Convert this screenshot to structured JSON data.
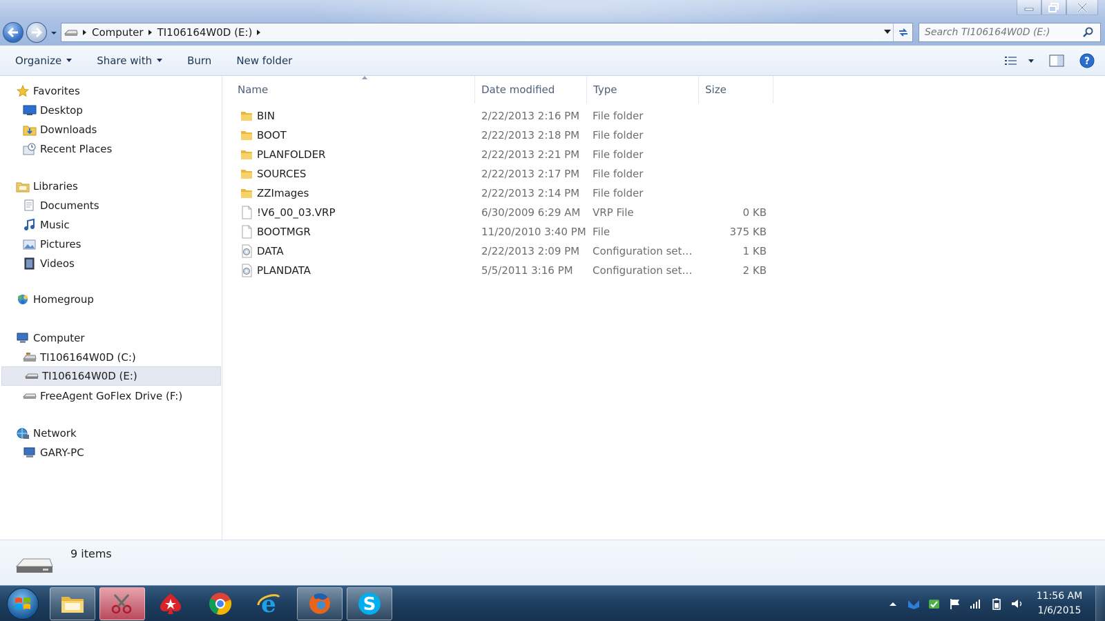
{
  "address": {
    "crumbs": [
      "Computer",
      "TI106164W0D (E:)"
    ]
  },
  "search": {
    "placeholder": "Search TI106164W0D (E:)"
  },
  "toolbar": {
    "organize": "Organize",
    "share_with": "Share with",
    "burn": "Burn",
    "new_folder": "New folder"
  },
  "nav": {
    "favorites": "Favorites",
    "desktop": "Desktop",
    "downloads": "Downloads",
    "recent_places": "Recent Places",
    "libraries": "Libraries",
    "documents": "Documents",
    "music": "Music",
    "pictures": "Pictures",
    "videos": "Videos",
    "homegroup": "Homegroup",
    "computer": "Computer",
    "drive_c": "TI106164W0D (C:)",
    "drive_e": "TI106164W0D (E:)",
    "drive_f": "FreeAgent GoFlex Drive (F:)",
    "network": "Network",
    "gary_pc": "GARY-PC"
  },
  "columns": {
    "name": "Name",
    "date": "Date modified",
    "type": "Type",
    "size": "Size"
  },
  "files": [
    {
      "name": "BIN",
      "date": "2/22/2013 2:16 PM",
      "type": "File folder",
      "size": "",
      "icon": "folder"
    },
    {
      "name": "BOOT",
      "date": "2/22/2013 2:18 PM",
      "type": "File folder",
      "size": "",
      "icon": "folder"
    },
    {
      "name": "PLANFOLDER",
      "date": "2/22/2013 2:21 PM",
      "type": "File folder",
      "size": "",
      "icon": "folder"
    },
    {
      "name": "SOURCES",
      "date": "2/22/2013 2:17 PM",
      "type": "File folder",
      "size": "",
      "icon": "folder"
    },
    {
      "name": "ZZImages",
      "date": "2/22/2013 2:14 PM",
      "type": "File folder",
      "size": "",
      "icon": "folder"
    },
    {
      "name": "!V6_00_03.VRP",
      "date": "6/30/2009 6:29 AM",
      "type": "VRP File",
      "size": "0 KB",
      "icon": "file"
    },
    {
      "name": "BOOTMGR",
      "date": "11/20/2010 3:40 PM",
      "type": "File",
      "size": "375 KB",
      "icon": "file"
    },
    {
      "name": "DATA",
      "date": "2/22/2013 2:09 PM",
      "type": "Configuration settin...",
      "size": "1 KB",
      "icon": "config"
    },
    {
      "name": "PLANDATA",
      "date": "5/5/2011 3:16 PM",
      "type": "Configuration settin...",
      "size": "2 KB",
      "icon": "config"
    }
  ],
  "status": {
    "item_count": "9 items"
  },
  "clock": {
    "time": "11:56 AM",
    "date": "1/6/2015"
  }
}
